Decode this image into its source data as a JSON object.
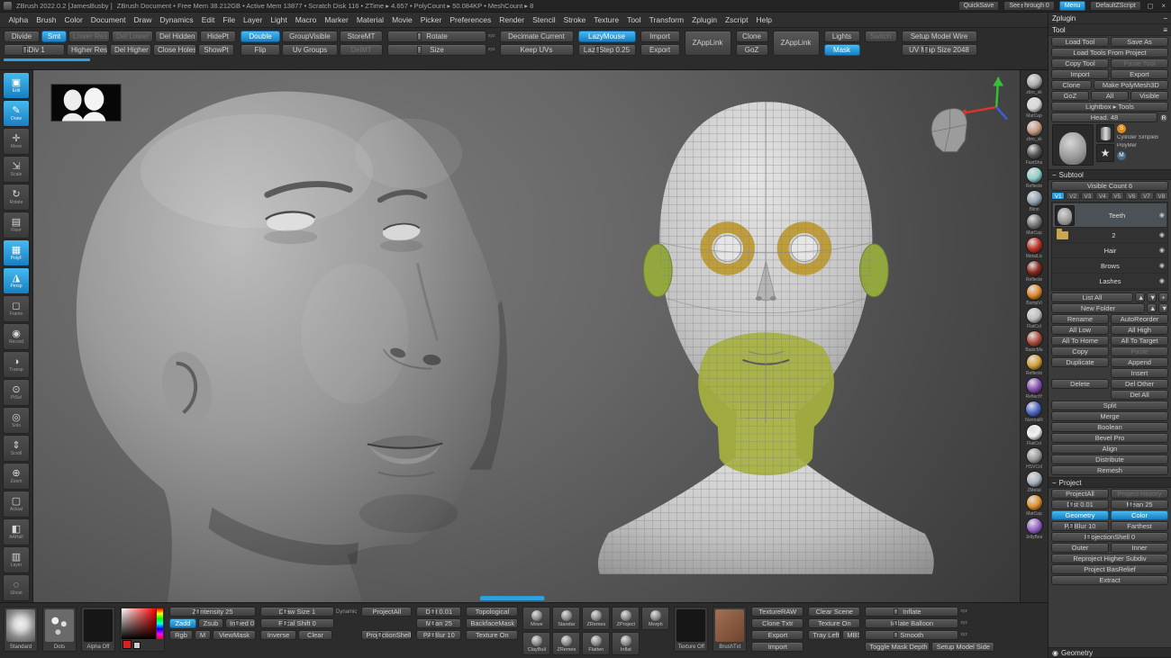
{
  "titlebar": {
    "app_title": "ZBrush 2022.0.2 [JamesBusby ]",
    "doc_status": "ZBrush Document • Free Mem 38.212GB • Active Mem 13877 • Scratch Disk 116 • ZTime ▸ 4.657 • PolyCount ▸ 50.084KP • MeshCount ▸ 8",
    "quicksave": "QuickSave",
    "see_through": "See-through 0",
    "menu": "Menu",
    "default_zscript": "DefaultZScript"
  },
  "menubar": {
    "items": [
      "Alpha",
      "Brush",
      "Color",
      "Document",
      "Draw",
      "Dynamics",
      "Edit",
      "File",
      "Layer",
      "Light",
      "Macro",
      "Marker",
      "Material",
      "Movie",
      "Picker",
      "Preferences",
      "Render",
      "Stencil",
      "Stroke",
      "Texture",
      "Tool",
      "Transform",
      "Zplugin",
      "Zscript",
      "Help"
    ]
  },
  "topshelf": {
    "divide": "Divide",
    "smt": "Smt",
    "lower_res": "Lower Res",
    "del_lower": "Del Lower",
    "del_hidden": "Del Hidden",
    "hidept": "HidePt",
    "sdiv": "SDiv 1",
    "higher_res": "Higher Res",
    "del_higher": "Del Higher",
    "close_holes": "Close Holes",
    "showpt": "ShowPt",
    "double": "Double",
    "groupvisible": "GroupVisible",
    "storemt": "StoreMT",
    "flip": "Flip",
    "uv_groups": "Uv Groups",
    "delmt": "DelMT",
    "rotate": "Rotate",
    "size": "Size",
    "xyz": "xyz",
    "decimate_current": "Decimate Current",
    "keep_uvs": "Keep UVs",
    "lazymouse": "LazyMouse",
    "lazystep": "LazyStep 0.25",
    "import": "Import",
    "export": "Export",
    "zapplink": "ZAppLink",
    "clone": "Clone",
    "goz": "GoZ",
    "zapplink2": "ZAppLink",
    "lights": "Lights",
    "mask": "Mask",
    "switch": "Switch",
    "setup_model_wire": "Setup Model Wire",
    "uv_map_size": "UV Map Size 2048"
  },
  "leftshelf": {
    "items": [
      {
        "glyph": "▣",
        "label": "Edit"
      },
      {
        "glyph": "✎",
        "label": "Draw"
      },
      {
        "glyph": "✛",
        "label": "Move"
      },
      {
        "glyph": "⇲",
        "label": "Scale"
      },
      {
        "glyph": "↻",
        "label": "Rotate"
      },
      {
        "glyph": "▤",
        "label": "Floor"
      },
      {
        "glyph": "▦",
        "label": "PolyF"
      },
      {
        "glyph": "◮",
        "label": "Persp"
      },
      {
        "glyph": "◻",
        "label": "Frame"
      },
      {
        "glyph": "◉",
        "label": "Record"
      },
      {
        "glyph": "◑",
        "label": "Transp"
      },
      {
        "glyph": "⊙",
        "label": "PtSel"
      },
      {
        "glyph": "◎",
        "label": "Solo"
      },
      {
        "glyph": "⇕",
        "label": "Scroll"
      },
      {
        "glyph": "⊕",
        "label": "Zoom"
      },
      {
        "glyph": "▢",
        "label": "Actual"
      },
      {
        "glyph": "◧",
        "label": "AAHalf"
      },
      {
        "glyph": "▥",
        "label": "Layer"
      },
      {
        "glyph": "◌",
        "label": "Ghost"
      }
    ]
  },
  "materials": {
    "items": [
      {
        "label": "zbro_sk",
        "color": "#b0b0b0"
      },
      {
        "label": "MatCap",
        "color": "#d8d8d8"
      },
      {
        "label": "zbro_sk",
        "color": "#c49a82"
      },
      {
        "label": "FastSha",
        "color": "#585858"
      },
      {
        "label": "Reflecte",
        "color": "#8fd0cc"
      },
      {
        "label": "Blinn",
        "color": "#94a4b4"
      },
      {
        "label": "MatCap",
        "color": "#787878"
      },
      {
        "label": "MetalLic",
        "color": "#c23528"
      },
      {
        "label": "Reflecte",
        "color": "#8a2a1e"
      },
      {
        "label": "BumpVi",
        "color": "#e08a2e"
      },
      {
        "label": "FlatCol",
        "color": "#bfbfbf"
      },
      {
        "label": "BasicMa",
        "color": "#b05040"
      },
      {
        "label": "Reflecte",
        "color": "#d4a238"
      },
      {
        "label": "ReflectY",
        "color": "#8a52b8"
      },
      {
        "label": "NormalR",
        "color": "#4f6ac8"
      },
      {
        "label": "FlatCol",
        "color": "#f2f2f2"
      },
      {
        "label": "HSVCol",
        "color": "#9c9c9c"
      },
      {
        "label": "ZMetal",
        "color": "#aab4be"
      },
      {
        "label": "MatCap",
        "color": "#e0922e"
      },
      {
        "label": "JellyBea",
        "color": "#9a66cc"
      }
    ]
  },
  "tool": {
    "zplugin_header": "Zplugin",
    "header": "Tool",
    "load_tool": "Load Tool",
    "save_as": "Save As",
    "load_tools_from_project": "Load Tools From Project",
    "copy_tool": "Copy Tool",
    "paste_tool": "Paste Tool",
    "import": "Import",
    "export": "Export",
    "clone": "Clone",
    "make_polymesh3d": "Make PolyMesh3D",
    "goz": "GoZ",
    "all": "All",
    "visible": "Visible",
    "lightbox_tools": "Lightbox ▸ Tools",
    "current_tool": "Head. 48",
    "thumb_cylinder_label": "Cylinder SimpleB",
    "thumb_star_label": "PolyMer",
    "subtool": {
      "header": "Subtool",
      "visible_count": "Visible Count 6",
      "vtabs": [
        "V1",
        "V2",
        "V3",
        "V4",
        "V5",
        "V6",
        "V7",
        "V8"
      ],
      "items": [
        {
          "name": "Teeth"
        },
        {
          "name": "2"
        },
        {
          "name": "Hair"
        },
        {
          "name": "Brows"
        },
        {
          "name": "Lashes"
        }
      ],
      "list_all": "List All",
      "new_folder": "New Folder",
      "rename": "Rename",
      "autoreorder": "AutoReorder",
      "all_low": "All Low",
      "all_high": "All High",
      "all_to_home": "All To Home",
      "all_to_target": "All To Target",
      "copy": "Copy",
      "paste": "Paste",
      "duplicate": "Duplicate",
      "append": "Append",
      "insert": "Insert",
      "delete": "Delete",
      "del_other": "Del Other",
      "del_all": "Del All",
      "split": "Split",
      "merge": "Merge",
      "boolean": "Boolean",
      "bevel_pro": "Bevel Pro",
      "align": "Align",
      "distribute": "Distribute",
      "remesh": "Remesh"
    },
    "project": {
      "header": "Project",
      "projectall": "ProjectAll",
      "project_history": "Project History",
      "dist": "Dist 0.01",
      "mean": "Mean 25",
      "geometry": "Geometry",
      "color": "Color",
      "pa_blur": "PA Blur 10",
      "farthest": "Farthest",
      "projectionshell": "ProjectionShell 0",
      "outer": "Outer",
      "inner": "Inner",
      "reproject_higher_subdiv": "Reproject Higher Subdiv",
      "project_basrelief": "Project BasRelief",
      "extract": "Extract"
    },
    "geometry_header": "Geometry"
  },
  "bottom": {
    "standard": "Standard",
    "dots": "Dots",
    "alpha_off": "Alpha Off",
    "z_intensity": "Z Intensity 25",
    "zadd": "Zadd",
    "zsub": "Zsub",
    "imbed": "Imbed 0",
    "rgb": "Rgb",
    "m": "M",
    "viewmask": "ViewMask",
    "draw_size": "Draw Size 1",
    "dynamic": "Dynamic",
    "focal_shift": "Focal Shift 0",
    "inverse": "Inverse",
    "clear": "Clear",
    "projectall": "ProjectAll",
    "dist": "Dist 0.01",
    "mean": "Mean 25",
    "pa_blur": "PA Blur 10",
    "projectionshell": "ProjectionShell 0",
    "topological": "Topological",
    "backfacemask": "BackfaceMask",
    "texture_on": "Texture On",
    "brushes": [
      "Move",
      "Standar",
      "ZRemes",
      "ZProject",
      "Morph",
      "ClayBuil",
      "ZRemes",
      "Flatten",
      "Inflat"
    ],
    "texture_off": "Texture Off",
    "brushtxt": "BrushTxt",
    "textureraw": "TextureRAW",
    "clone_txtr": "Clone Txtr",
    "export": "Export",
    "import": "Import",
    "clear_scene": "Clear Scene",
    "texture_on2": "Texture On",
    "tray_left": "Tray Left",
    "mbs": "MBS",
    "toggle_mask_depth": "Toggle Mask Depth",
    "setup_model_side": "Setup Model Side",
    "inflate": "Inflate",
    "inflate_balloon": "Inflate Balloon",
    "smooth": "Smooth"
  },
  "canvas": {
    "axis_x": "#e03228",
    "axis_y": "#35c035",
    "axis_z": "#3a5fd8",
    "polygroup_jaw": "#a6b13f",
    "polygroup_eyes": "#bf9d3a",
    "polygroup_ears": "#92a73d"
  },
  "color_picker": {
    "current": "#dd1f1f",
    "secondary": "#cccccc"
  },
  "icons": {
    "up": "▲",
    "down": "▼",
    "plus": "+",
    "eye": "◉",
    "burger": "≡",
    "collapse": "−",
    "r_badge": "R",
    "s_badge": "S",
    "m_badge": "M",
    "close": "×",
    "restore": "◻"
  }
}
